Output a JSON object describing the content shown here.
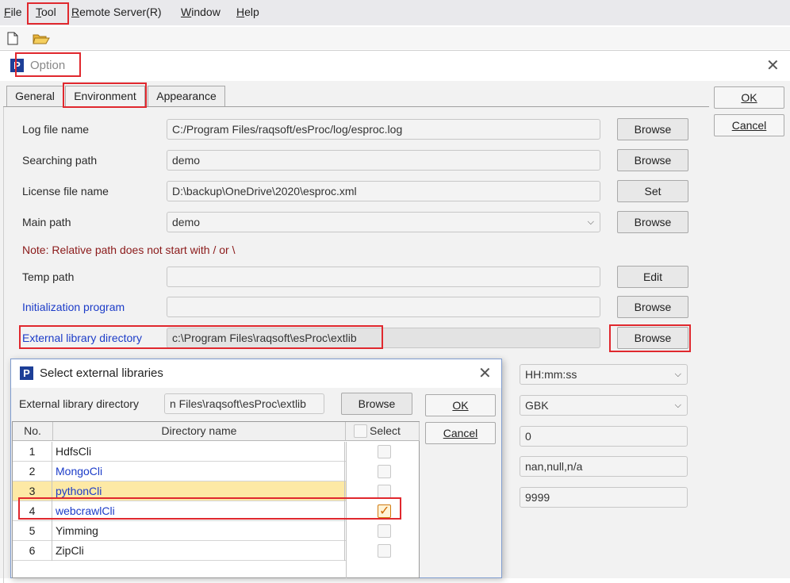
{
  "menubar": {
    "file": "File",
    "tool": "Tool",
    "remote": "Remote Server(R)",
    "window": "Window",
    "help": "Help"
  },
  "option_dialog": {
    "title": "Option",
    "tabs": [
      {
        "label": "General"
      },
      {
        "label": "Environment",
        "active": true
      },
      {
        "label": "Appearance"
      }
    ],
    "ok_label": "OK",
    "cancel_label": "Cancel",
    "fields": {
      "log_file": {
        "label": "Log file name",
        "value": "C:/Program Files/raqsoft/esProc/log/esproc.log",
        "button": "Browse"
      },
      "search_path": {
        "label": "Searching path",
        "value": "demo",
        "button": "Browse"
      },
      "license": {
        "label": "License file name",
        "value": "D:\\backup\\OneDrive\\2020\\esproc.xml",
        "button": "Set"
      },
      "main_path": {
        "label": "Main path",
        "value": "demo",
        "button": "Browse"
      },
      "note": "Note: Relative path does not start with / or \\",
      "temp_path": {
        "label": "Temp path",
        "value": "",
        "button": "Edit"
      },
      "init_program": {
        "label": "Initialization program",
        "value": "",
        "button": "Browse"
      },
      "ext_lib": {
        "label": "External library directory",
        "value": "c:\\Program Files\\raqsoft\\esProc\\extlib",
        "button": "Browse"
      }
    },
    "right_fields": {
      "time_format": "HH:mm:ss",
      "charset": "GBK",
      "value3": "0",
      "null_strings": "nan,null,n/a",
      "value5": "9999"
    }
  },
  "select_dialog": {
    "title": "Select external libraries",
    "dir_label": "External library directory",
    "dir_value": "n Files\\raqsoft\\esProc\\extlib",
    "browse_label": "Browse",
    "ok_label": "OK",
    "cancel_label": "Cancel",
    "columns": {
      "no": "No.",
      "name": "Directory name",
      "select": "Select"
    },
    "rows": [
      {
        "no": "1",
        "name": "HdfsCli",
        "checked": false
      },
      {
        "no": "2",
        "name": "MongoCli",
        "checked": false
      },
      {
        "no": "3",
        "name": "pythonCli",
        "checked": false
      },
      {
        "no": "4",
        "name": "webcrawlCli",
        "checked": true
      },
      {
        "no": "5",
        "name": "Yimming",
        "checked": false
      },
      {
        "no": "6",
        "name": "ZipCli",
        "checked": false
      }
    ]
  },
  "colors": {
    "highlight_box": "#e0282e",
    "link_blue": "#1c3cc8",
    "row_highlight": "#fde9a5"
  }
}
